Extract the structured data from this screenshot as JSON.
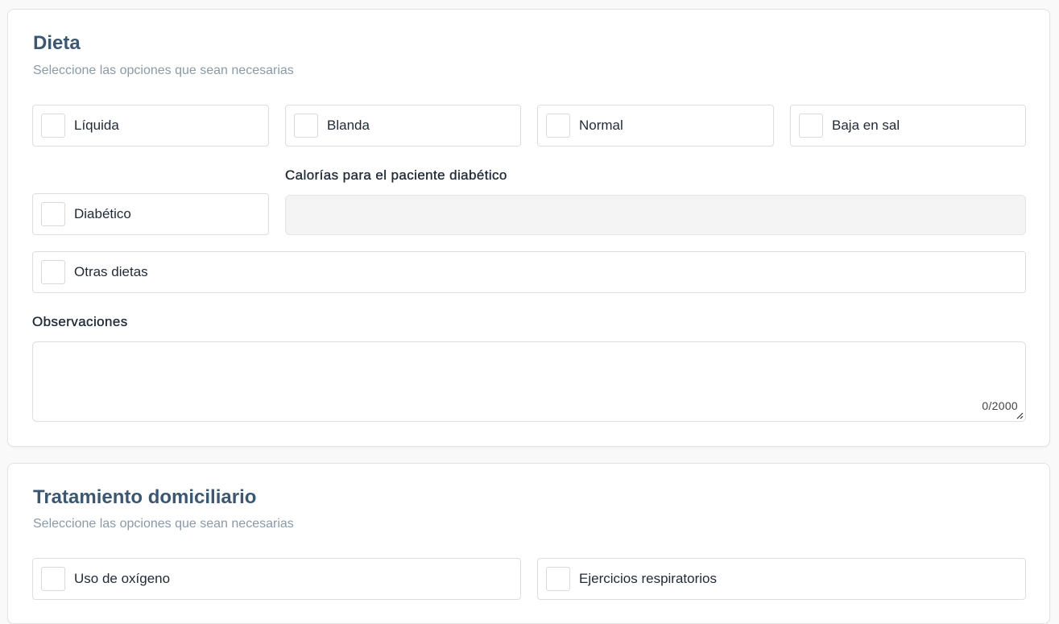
{
  "dieta": {
    "title": "Dieta",
    "subtitle": "Seleccione las opciones que sean necesarias",
    "options": [
      {
        "label": "Líquida",
        "checked": false
      },
      {
        "label": "Blanda",
        "checked": false
      },
      {
        "label": "Normal",
        "checked": false
      },
      {
        "label": "Baja en sal",
        "checked": false
      },
      {
        "label": "Diabético",
        "checked": false
      },
      {
        "label": "Otras dietas",
        "checked": false
      }
    ],
    "calorias_label": "Calorías para el paciente diabético",
    "calorias_value": "",
    "observaciones_label": "Observaciones",
    "observaciones_value": "",
    "observaciones_counter": "0/2000"
  },
  "tratamiento": {
    "title": "Tratamiento domiciliario",
    "subtitle": "Seleccione las opciones que sean necesarias",
    "options": [
      {
        "label": "Uso de oxígeno",
        "checked": false
      },
      {
        "label": "Ejercicios respiratorios",
        "checked": false
      }
    ]
  }
}
